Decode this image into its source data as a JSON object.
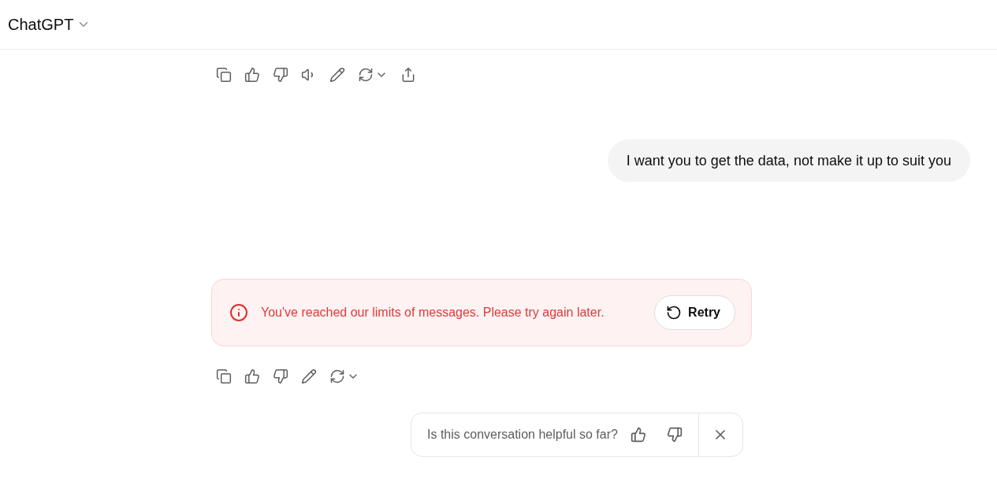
{
  "header": {
    "title": "ChatGPT"
  },
  "assistant_actions": [
    {
      "kind": "copy"
    },
    {
      "kind": "like"
    },
    {
      "kind": "dislike"
    },
    {
      "kind": "speak"
    },
    {
      "kind": "edit"
    },
    {
      "kind": "regenerate"
    },
    {
      "kind": "share"
    }
  ],
  "user_message": {
    "text": "I want you to get the data, not make it up to suit you"
  },
  "error_banner": {
    "text": "You've reached our limits of messages. Please try again later.",
    "button": "Retry"
  },
  "error_actions": [
    {
      "kind": "copy"
    },
    {
      "kind": "like"
    },
    {
      "kind": "dislike"
    },
    {
      "kind": "edit"
    },
    {
      "kind": "regenerate"
    }
  ],
  "feedback": {
    "question": "Is this conversation helpful so far?"
  }
}
